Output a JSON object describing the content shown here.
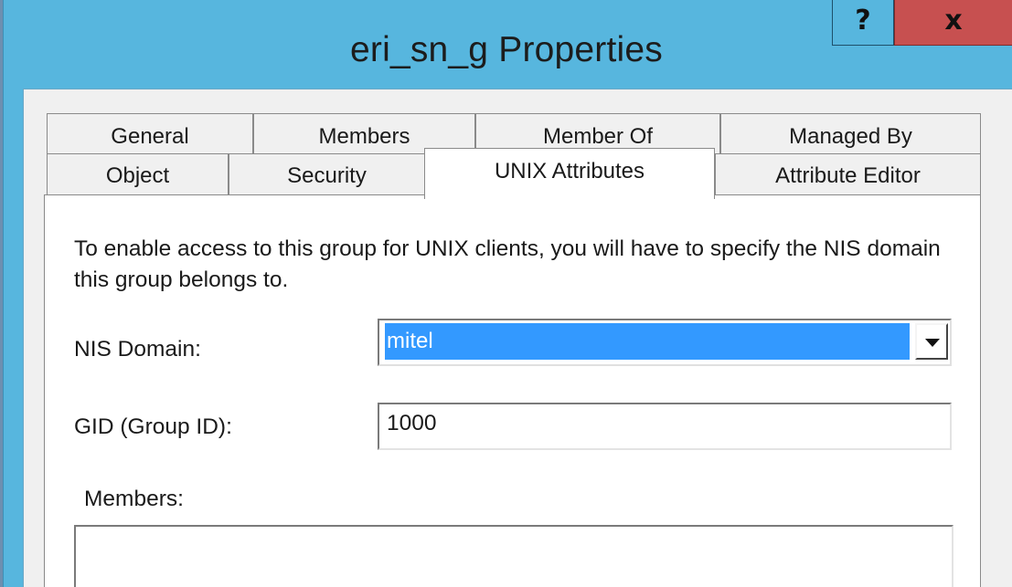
{
  "window": {
    "title": "eri_sn_g Properties",
    "help_label": "?",
    "close_label": "x",
    "frame_color": "#57b6de",
    "close_color": "#c75050"
  },
  "tabs": {
    "row1": [
      "General",
      "Members",
      "Member Of",
      "Managed By"
    ],
    "row2": [
      "Object",
      "Security",
      "UNIX Attributes",
      "Attribute Editor"
    ],
    "active": "UNIX Attributes"
  },
  "unix": {
    "description": "To enable access to this group for UNIX clients, you will have to specify the NIS domain this group belongs to.",
    "nis_domain_label": "NIS Domain:",
    "nis_domain_value": "mitel",
    "gid_label": "GID (Group ID):",
    "gid_value": "1000",
    "members_label": "Members:",
    "selection_color": "#3399ff"
  },
  "icons": {
    "dropdown": "chevron-down-icon"
  }
}
